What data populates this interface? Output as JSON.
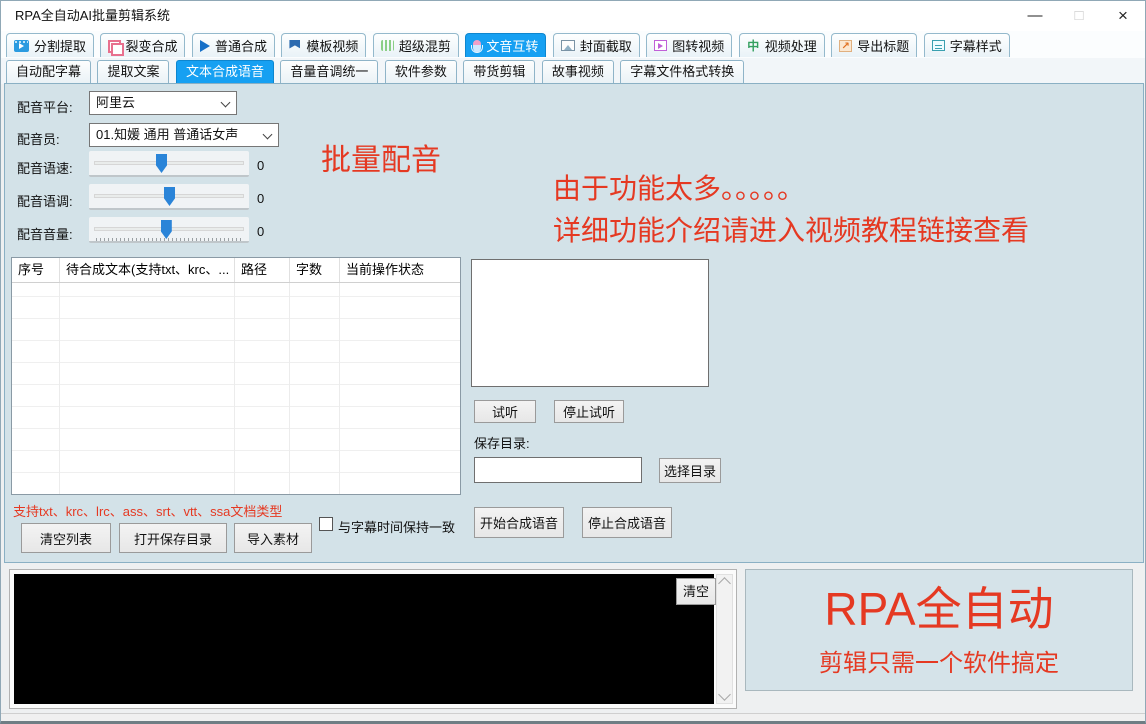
{
  "window": {
    "title": "RPA全自动AI批量剪辑系统",
    "minimize": "—",
    "maximize": "□",
    "close": "×"
  },
  "main_tabs": [
    {
      "label": "分割提取",
      "icon": "film-play-icon",
      "selected": false
    },
    {
      "label": "裂变合成",
      "icon": "fission-squares-icon",
      "selected": false
    },
    {
      "label": "普通合成",
      "icon": "play-icon",
      "selected": false
    },
    {
      "label": "模板视频",
      "icon": "flag-icon",
      "selected": false
    },
    {
      "label": "超级混剪",
      "icon": "sound-wave-icon",
      "selected": false
    },
    {
      "label": "文音互转",
      "icon": "microphone-icon",
      "selected": true
    },
    {
      "label": "封面截取",
      "icon": "image-icon",
      "selected": false
    },
    {
      "label": "图转视频",
      "icon": "image-play-icon",
      "selected": false
    },
    {
      "label": "视频处理",
      "icon": "video-process-icon",
      "selected": false
    },
    {
      "label": "导出标题",
      "icon": "export-icon",
      "selected": false
    },
    {
      "label": "字幕样式",
      "icon": "subtitle-style-icon",
      "selected": false
    }
  ],
  "sub_tabs": [
    {
      "label": "自动配字幕",
      "selected": false
    },
    {
      "label": "提取文案",
      "selected": false
    },
    {
      "label": "文本合成语音",
      "selected": true
    },
    {
      "label": "音量音调统一",
      "selected": false
    },
    {
      "label": "软件参数",
      "selected": false
    },
    {
      "label": "带货剪辑",
      "selected": false
    },
    {
      "label": "故事视频",
      "selected": false
    },
    {
      "label": "字幕文件格式转换",
      "selected": false
    }
  ],
  "form": {
    "platform_label": "配音平台:",
    "platform_value": "阿里云",
    "voice_label": "配音员:",
    "voice_value": "01.知媛 通用 普通话女声",
    "sliders": [
      {
        "label": "配音语速:",
        "value": "0",
        "percent": 45
      },
      {
        "label": "配音语调:",
        "value": "0",
        "percent": 50
      },
      {
        "label": "配音音量:",
        "value": "0",
        "percent": 48
      }
    ]
  },
  "annotations": {
    "batch_dubbing": "批量配音",
    "line1": "由于功能太多。。。。。",
    "line2": "详细功能介绍请进入视频教程链接查看"
  },
  "table": {
    "headers": [
      "序号",
      "待合成文本(支持txt、krc、...",
      "路径",
      "字数",
      "当前操作状态"
    ],
    "rows": []
  },
  "right_panel": {
    "preview_text": "",
    "listen_button": "试听",
    "stop_listen_button": "停止试听",
    "save_dir_label": "保存目录:",
    "save_dir_value": "",
    "choose_dir_button": "选择目录",
    "start_button": "开始合成语音",
    "stop_button": "停止合成语音"
  },
  "bottom_left": {
    "support_note": "支持txt、krc、lrc、ass、srt、vtt、ssa文档类型",
    "checkbox_label": "与字幕时间保持一致",
    "checkbox_checked": false,
    "clear_list_button": "清空列表",
    "open_dir_button": "打开保存目录",
    "import_button": "导入素材"
  },
  "log": {
    "clear_button": "清空",
    "content": ""
  },
  "branding": {
    "title": "RPA全自动",
    "subtitle": "剪辑只需一个软件搞定"
  },
  "colors": {
    "accent_blue": "#16a0f2",
    "annotation_red": "#e53922",
    "page_bg": "#d3e2e8",
    "log_bg": "#000000"
  }
}
